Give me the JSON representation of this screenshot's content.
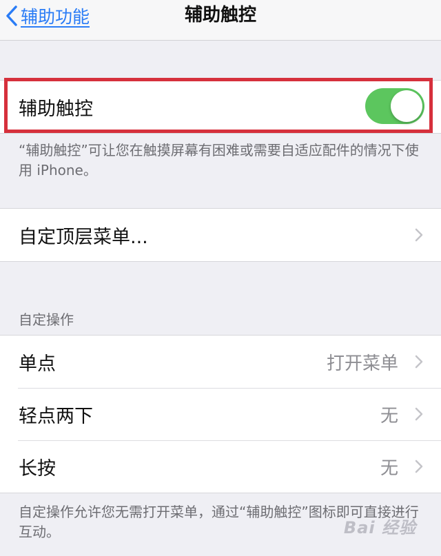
{
  "navbar": {
    "back_label": "辅助功能",
    "title": "辅助触控"
  },
  "assistive_touch": {
    "label": "辅助触控",
    "toggle_on": true,
    "description": "“辅助触控”可让您在触摸屏幕有困难或需要自适应配件的情况下使用 iPhone。"
  },
  "top_menu": {
    "label": "自定顶层菜单..."
  },
  "custom_actions": {
    "header": "自定操作",
    "rows": [
      {
        "label": "单点",
        "value": "打开菜单"
      },
      {
        "label": "轻点两下",
        "value": "无"
      },
      {
        "label": "长按",
        "value": "无"
      }
    ],
    "footer": "自定操作允许您无需打开菜单，通过“辅助触控”图标即可直接进行互动。"
  },
  "colors": {
    "tint": "#2a7cf6",
    "toggle_on": "#5cc65e",
    "highlight": "#d6303c",
    "background": "#efeff4"
  },
  "watermark": "Bai 经验"
}
